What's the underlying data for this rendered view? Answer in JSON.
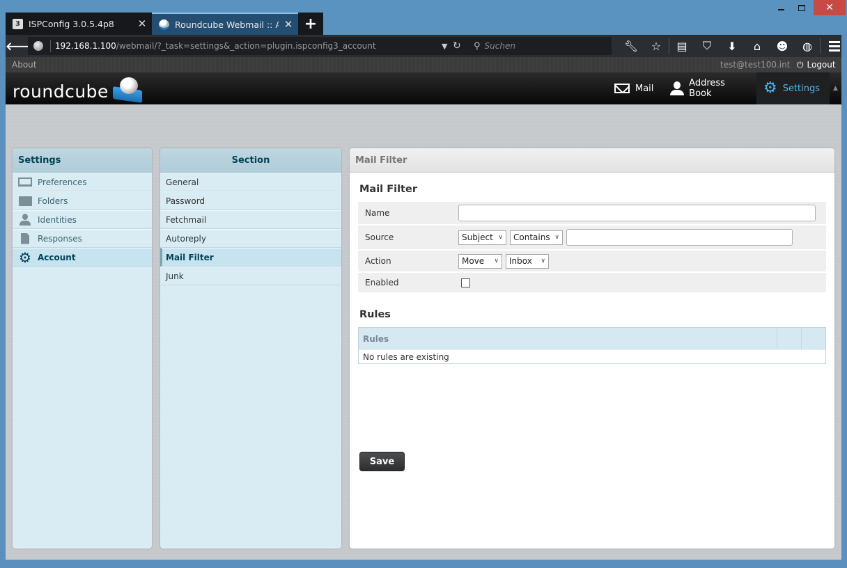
{
  "browser": {
    "tabs": [
      {
        "title": "ISPConfig 3.0.5.4p8",
        "icon": "ispconfig-favicon",
        "active": false
      },
      {
        "title": "Roundcube Webmail :: Ac...",
        "icon": "roundcube-favicon",
        "active": true
      }
    ],
    "new_tab_label": "+",
    "url_host": "192.168.1.100",
    "url_path": "/webmail/?_task=settings&_action=plugin.ispconfig3_account",
    "search_placeholder": "Suchen",
    "toolbar_icons": [
      "wrench-icon",
      "bookmark-star-icon",
      "reading-list-icon",
      "pocket-icon",
      "download-icon",
      "home-icon",
      "chat-icon",
      "web-developer-icon",
      "menu-icon"
    ]
  },
  "topline": {
    "about_label": "About",
    "user_email": "test@test100.int",
    "logout_label": "Logout"
  },
  "header": {
    "logo_text": "roundcube",
    "nav": [
      {
        "label": "Mail",
        "icon": "mail-icon",
        "selected": false
      },
      {
        "label": "Address Book",
        "icon": "address-book-icon",
        "selected": false
      },
      {
        "label": "Settings",
        "icon": "gear-icon",
        "selected": true
      }
    ],
    "accent_color": "#4fb6ec"
  },
  "settings_panel": {
    "title": "Settings",
    "items": [
      {
        "label": "Preferences",
        "icon": "preferences-icon"
      },
      {
        "label": "Folders",
        "icon": "folder-icon"
      },
      {
        "label": "Identities",
        "icon": "identity-icon"
      },
      {
        "label": "Responses",
        "icon": "response-icon"
      },
      {
        "label": "Account",
        "icon": "gear-icon",
        "selected": true
      }
    ]
  },
  "section_panel": {
    "title": "Section",
    "items": [
      {
        "label": "General"
      },
      {
        "label": "Password"
      },
      {
        "label": "Fetchmail"
      },
      {
        "label": "Autoreply"
      },
      {
        "label": "Mail Filter",
        "selected": true
      },
      {
        "label": "Junk"
      }
    ]
  },
  "main": {
    "header": "Mail Filter",
    "form_title": "Mail Filter",
    "fields": {
      "name": {
        "label": "Name",
        "value": ""
      },
      "source": {
        "label": "Source",
        "field_select": "Subject",
        "op_select": "Contains",
        "value": ""
      },
      "action": {
        "label": "Action",
        "action_select": "Move",
        "folder_select": "Inbox"
      },
      "enabled": {
        "label": "Enabled",
        "checked": false
      }
    },
    "rules_title": "Rules",
    "rules_column": "Rules",
    "rules_empty": "No rules are existing",
    "save_label": "Save"
  }
}
